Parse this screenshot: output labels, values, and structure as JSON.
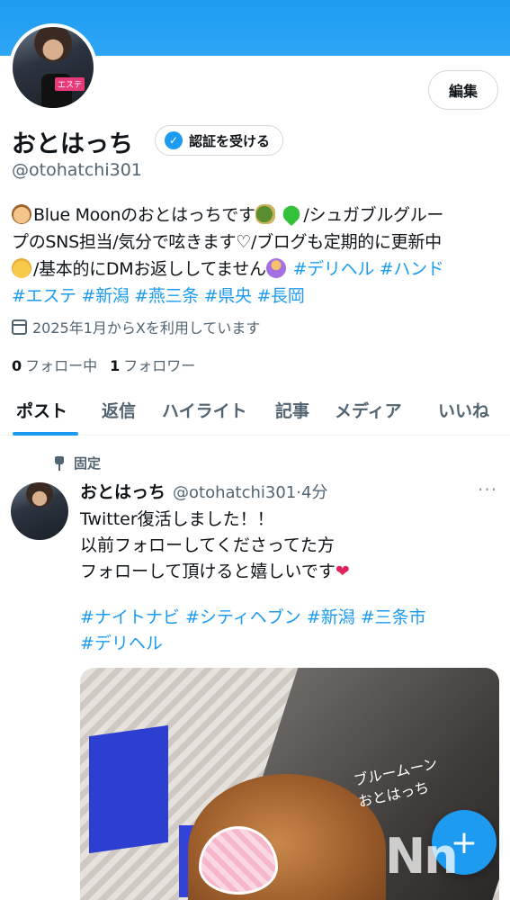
{
  "profile": {
    "name": "おとはっち",
    "handle": "@otohatchi301",
    "verify_label": "認証を受ける",
    "edit_label": "編集",
    "avatar_badge": "エステ",
    "bio_parts": {
      "line1_text": "Blue Moonのおとはっちです",
      "line1_rest": "/シュガブルグルー",
      "line2": "プのSNS担当/気分で呟きます♡/ブログも定期的に更新中",
      "line3_text": "/基本的にDMお返ししてません",
      "line3_tags": "#デリヘル #ハンド",
      "line4_tags": "#エステ #新潟 #燕三条 #県央 #長岡"
    },
    "joined": "2025年1月からXを利用しています",
    "following_count": "0",
    "following_label": "フォロー中",
    "followers_count": "1",
    "followers_label": "フォロワー"
  },
  "tabs": [
    "ポスト",
    "返信",
    "ハイライト",
    "記事",
    "メディア",
    "いいね"
  ],
  "post": {
    "pinned_label": "固定",
    "author": "おとはっち",
    "meta": "@otohatchi301·4分",
    "more": "···",
    "lines": [
      "Twitter復活しました！！",
      "以前フォローしてくださってた方",
      "フォローして頂けると嬉しいです"
    ],
    "tags_line1": "#ナイトナビ #シティヘブン #新潟 #三条市",
    "tags_line2": "#デリヘル",
    "media_caption": [
      "ブルームーン",
      "おとはっち"
    ]
  },
  "fab_label": "+",
  "watermark": "Nn",
  "colors": {
    "accent": "#1d9bf0",
    "text": "#0f1419",
    "secondary": "#536471"
  }
}
